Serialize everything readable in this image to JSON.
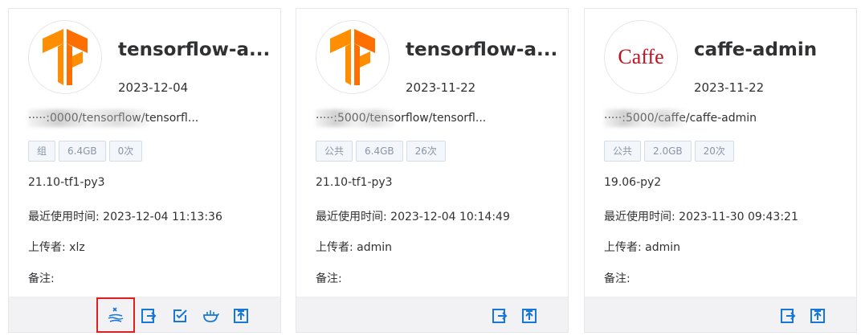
{
  "cards": [
    {
      "name": "tensorflow-a...",
      "date": "2023-12-04",
      "path": "·····:0000/tensorflow/tensorfl...",
      "tags": [
        "组",
        "6.4GB",
        "0次"
      ],
      "version": "21.10-tf1-py3",
      "last_used_label": "最近使用时间:",
      "last_used": "2023-12-04 11:13:36",
      "uploader_label": "上传者:",
      "uploader": "xlz",
      "remark_label": "备注:",
      "actions": [
        "delete-image-icon",
        "edit-icon",
        "checkbox-edit-icon",
        "docker-icon",
        "export-icon"
      ]
    },
    {
      "name": "tensorflow-a...",
      "date": "2023-11-22",
      "path": "·····:5000/tensorflow/tensorfl...",
      "tags": [
        "公共",
        "6.4GB",
        "26次"
      ],
      "version": "21.10-tf1-py3",
      "last_used_label": "最近使用时间:",
      "last_used": "2023-12-04 10:14:49",
      "uploader_label": "上传者:",
      "uploader": "admin",
      "remark_label": "备注:",
      "actions": [
        "edit-icon",
        "export-icon"
      ]
    },
    {
      "name": "caffe-admin",
      "logo_text": "Caffe",
      "date": "2023-11-22",
      "path": "·····:5000/caffe/caffe-admin",
      "tags": [
        "公共",
        "2.0GB",
        "20次"
      ],
      "version": "19.06-py2",
      "last_used_label": "最近使用时间:",
      "last_used": "2023-11-30 09:43:21",
      "uploader_label": "上传者:",
      "uploader": "admin",
      "remark_label": "备注:",
      "actions": [
        "edit-icon",
        "export-icon"
      ]
    }
  ],
  "colors": {
    "tf_orange": "#ff8f00",
    "tf_orange_dark": "#ff6f00",
    "icon_blue": "#1677d9",
    "highlight_red": "#e02020",
    "caffe_red": "#c0121f"
  }
}
